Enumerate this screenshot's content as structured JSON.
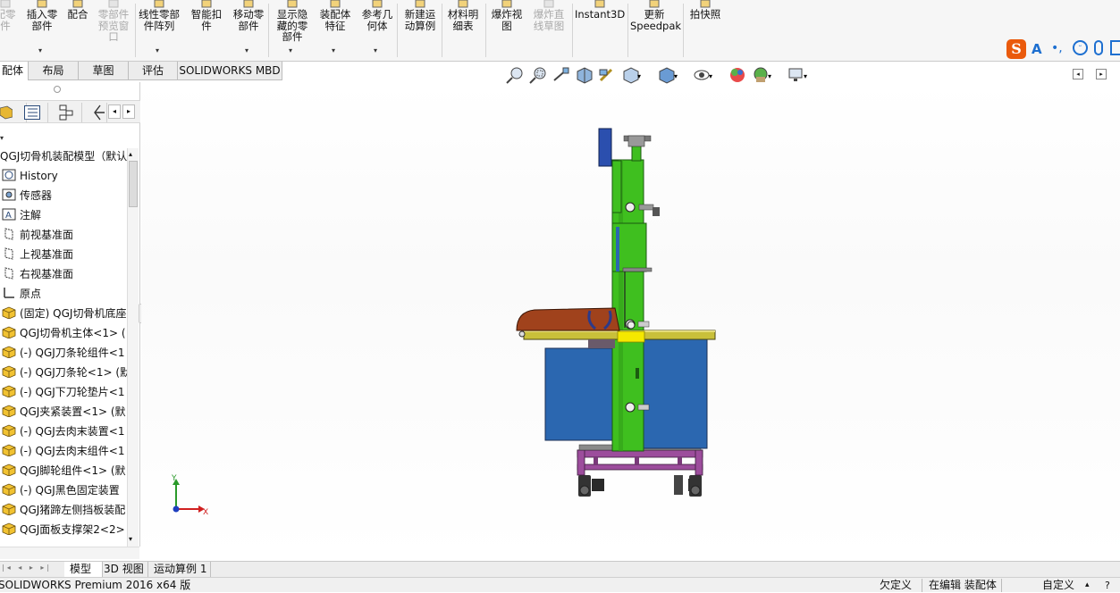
{
  "ribbon": {
    "buttons": [
      {
        "label": "配零\n件",
        "gray": true
      },
      {
        "label": "插入零\n部件",
        "gray": false
      },
      {
        "label": "配合",
        "gray": false
      },
      {
        "label": "零部件\n预览窗\n口",
        "gray": true
      },
      {
        "label": "线性零部\n件阵列",
        "gray": false
      },
      {
        "label": "智能扣\n件",
        "gray": false
      },
      {
        "label": "移动零\n部件",
        "gray": false
      },
      {
        "label": "显示隐\n藏的零\n部件",
        "gray": false
      },
      {
        "label": "装配体\n特征",
        "gray": false
      },
      {
        "label": "参考几\n何体",
        "gray": false
      },
      {
        "label": "新建运\n动算例",
        "gray": false
      },
      {
        "label": "材料明\n细表",
        "gray": false
      },
      {
        "label": "爆炸视\n图",
        "gray": false
      },
      {
        "label": "爆炸直\n线草图",
        "gray": true
      },
      {
        "label": "Instant3D",
        "gray": false
      },
      {
        "label": "更新\nSpeedpak",
        "gray": false
      },
      {
        "label": "拍快照",
        "gray": false
      }
    ]
  },
  "tabs": [
    "配体",
    "布局",
    "草图",
    "评估",
    "SOLIDWORKS MBD"
  ],
  "tree": {
    "root": "QGJ切骨机装配模型（默认",
    "items": [
      "History",
      "传感器",
      "注解",
      "前视基准面",
      "上视基准面",
      "右视基准面",
      "原点",
      "(固定) QGJ切骨机底座",
      "QGJ切骨机主体<1> (",
      "(-) QGJ刀条轮组件<1",
      "(-) QGJ刀条轮<1> (默",
      "(-) QGJ下刀轮垫片<1",
      "QGJ夹紧装置<1> (默",
      "(-) QGJ去肉末装置<1",
      "(-) QGJ去肉末组件<1",
      "QGJ脚轮组件<1> (默",
      "(-) QGJ黑色固定装置",
      "QGJ猪蹄左侧挡板装配",
      "QGJ面板支撑架2<2> (默"
    ]
  },
  "bottom_tabs": [
    "模型",
    "3D 视图",
    "运动算例 1"
  ],
  "status": {
    "app": "SOLIDWORKS Premium 2016 x64 版",
    "underdefined": "欠定义",
    "editing": "在编辑 装配体",
    "units": "自定义"
  },
  "triad": {
    "x": "X",
    "y": "Y"
  },
  "colors": {
    "green": "#3fbf1f",
    "blue": "#2b67b0",
    "purple": "#9c4d9c",
    "brown": "#a0421c",
    "yellow": "#f5e800",
    "tan": "#c9c03a"
  }
}
